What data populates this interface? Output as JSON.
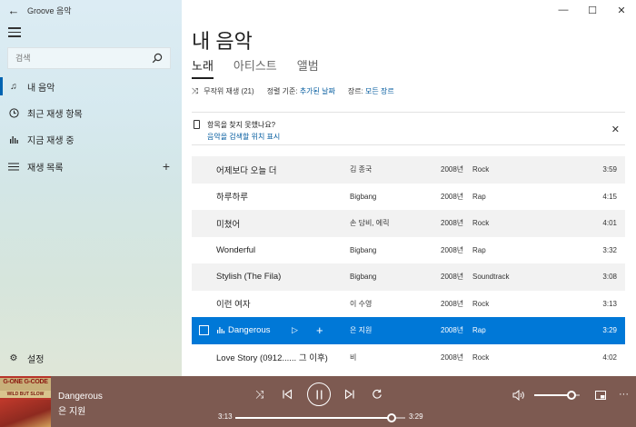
{
  "window": {
    "app_title": "Groove 음악",
    "back_icon": "back-arrow-icon",
    "minimize_icon": "minimize-icon",
    "maximize_icon": "maximize-icon",
    "close_icon": "close-icon"
  },
  "sidebar": {
    "search": {
      "placeholder": "검색",
      "icon": "search-icon"
    },
    "items": [
      {
        "label": "내 음악",
        "icon": "music-note-icon",
        "active": true
      },
      {
        "label": "최근 재생 항목",
        "icon": "clock-icon"
      },
      {
        "label": "지금 재생 중",
        "icon": "bars-icon"
      },
      {
        "label": "재생 목록",
        "icon": "list-icon",
        "action_icon": "plus-icon"
      }
    ],
    "settings": {
      "label": "설정",
      "icon": "gear-icon"
    }
  },
  "main": {
    "title": "내 음악",
    "tabs": [
      {
        "label": "노래",
        "active": true
      },
      {
        "label": "아티스트"
      },
      {
        "label": "앨범"
      }
    ],
    "filters": {
      "shuffle": "무작위 재생 (21)",
      "sort_label": "정렬 기준:",
      "sort_value": "추가된 날짜",
      "genre_label": "장르:",
      "genre_value": "모든 장르"
    },
    "notice": {
      "question": "항목을 찾지 못했나요?",
      "link": "음악을 검색할 위치 표시"
    },
    "songs": [
      {
        "title": "어제보다 오늘 더",
        "artist": "김 종국",
        "year": "2008년",
        "genre": "Rock",
        "duration": "3:59"
      },
      {
        "title": "하루하루",
        "artist": "Bigbang",
        "year": "2008년",
        "genre": "Rap",
        "duration": "4:15"
      },
      {
        "title": "미쳤어",
        "artist": "손 담비, 에릭",
        "year": "2008년",
        "genre": "Rock",
        "duration": "4:01"
      },
      {
        "title": "Wonderful",
        "artist": "Bigbang",
        "year": "2008년",
        "genre": "Rap",
        "duration": "3:32"
      },
      {
        "title": "Stylish (The Fila)",
        "artist": "Bigbang",
        "year": "2008년",
        "genre": "Soundtrack",
        "duration": "3:08"
      },
      {
        "title": "이런 여자",
        "artist": "이 수영",
        "year": "2008년",
        "genre": "Rock",
        "duration": "3:13"
      },
      {
        "title": "Dangerous",
        "artist": "은 지원",
        "year": "2008년",
        "genre": "Rap",
        "duration": "3:29",
        "selected": true
      },
      {
        "title": "Love Story (0912...... 그 이후)",
        "artist": "비",
        "year": "2008년",
        "genre": "Rock",
        "duration": "4:02"
      }
    ]
  },
  "player": {
    "title": "Dangerous",
    "artist": "은 지원",
    "current_time": "3:13",
    "end_time": "3:29",
    "progress": 0.92,
    "volume": 0.82,
    "album_art_text": [
      "G-ONE",
      "G-CODE",
      "WILD BUT SLOW"
    ],
    "colors": {
      "bar": "#7d5a51",
      "accent": "#0078d7"
    }
  }
}
